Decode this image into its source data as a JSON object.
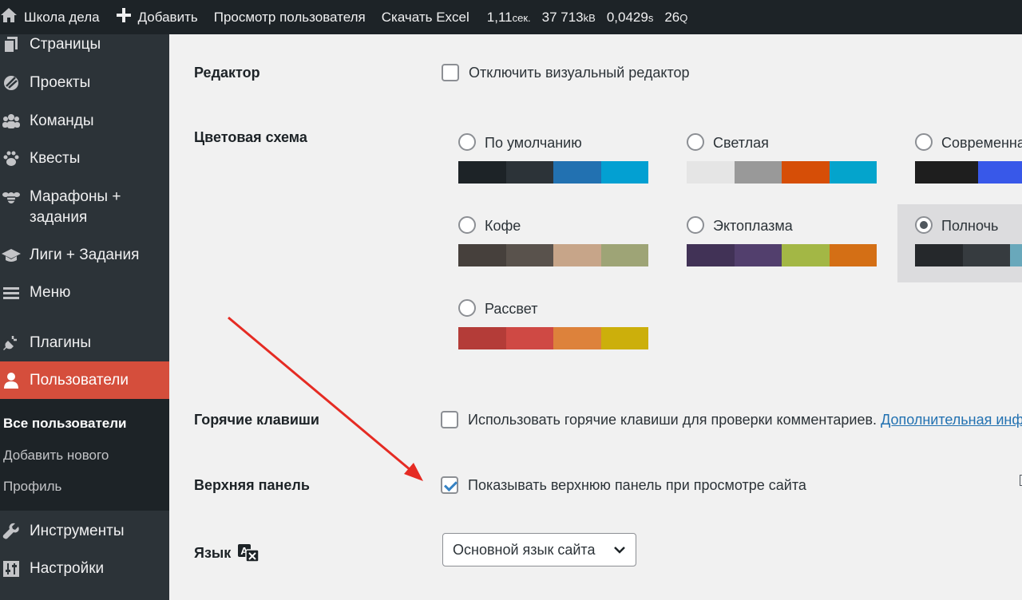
{
  "adminbar": {
    "site_name": "Школа дела",
    "add_label": "Добавить",
    "view_user": "Просмотр пользователя",
    "download_excel": "Скачать Excel",
    "time_value": "1,11",
    "time_unit": "сек.",
    "memory_value": "37 713",
    "memory_unit": "kB",
    "db_time_value": "0,0429",
    "db_time_unit": "s",
    "queries_value": "26",
    "queries_unit": "Q"
  },
  "sidebar": {
    "items": [
      {
        "label": "Страницы",
        "icon": "pages-icon"
      },
      {
        "label": "Проекты",
        "icon": "projects-icon"
      },
      {
        "label": "Команды",
        "icon": "teams-icon"
      },
      {
        "label": "Квесты",
        "icon": "paw-icon"
      },
      {
        "label": "Марафоны +",
        "label2": "задания",
        "icon": "bee-icon"
      },
      {
        "label": "Лиги + Задания",
        "icon": "graduation-cap-icon"
      },
      {
        "label": "Меню",
        "icon": "menu-icon"
      },
      {
        "label": "Плагины",
        "icon": "plugins-icon"
      },
      {
        "label": "Пользователи",
        "icon": "user-icon"
      },
      {
        "label": "Инструменты",
        "icon": "wrench-icon"
      },
      {
        "label": "Настройки",
        "icon": "settings-icon"
      }
    ],
    "submenu": [
      "Все пользователи",
      "Добавить нового",
      "Профиль"
    ]
  },
  "profile": {
    "editor_label": "Редактор",
    "editor_checkbox": "Отключить визуальный редактор",
    "color_scheme_label": "Цветовая схема",
    "schemes": [
      {
        "name": "По умолчанию",
        "colors": [
          "#1d2327",
          "#2c3338",
          "#2271b1",
          "#72aee6"
        ]
      },
      {
        "name": "Светлая",
        "colors": [
          "#e5e5e5",
          "#999999",
          "#d64e07",
          "#04a4cc"
        ]
      },
      {
        "name": "Современная",
        "colors": [
          "#1e1e1e",
          "#3858e9",
          "#33f078"
        ]
      },
      {
        "name": "Кофе",
        "colors": [
          "#46403c",
          "#59524c",
          "#c7a589",
          "#9ea476"
        ]
      },
      {
        "name": "Эктоплазма",
        "colors": [
          "#413256",
          "#523f6d",
          "#a3b745",
          "#d46f15"
        ]
      },
      {
        "name": "Полночь",
        "colors": [
          "#25282b",
          "#363b3f",
          "#69a8bb",
          "#e14d43"
        ]
      },
      {
        "name": "Рассвет",
        "colors": [
          "#b43c38",
          "#cf4944",
          "#dd823b",
          "#ccaf0b"
        ]
      }
    ],
    "selected_scheme": "Полночь",
    "hotkeys_label": "Горячие клавиши",
    "hotkeys_checkbox": "Использовать горячие клавиши для проверки комментариев.",
    "hotkeys_link": "Дополнительная информация",
    "toolbar_label": "Верхняя панель",
    "toolbar_checkbox": "Показывать верхнюю панель при просмотре сайта",
    "language_label": "Язык",
    "language_value": "Основной язык сайта"
  },
  "colors": {
    "accent": "#d54e3c",
    "annotation_arrow": "#e52b23"
  }
}
